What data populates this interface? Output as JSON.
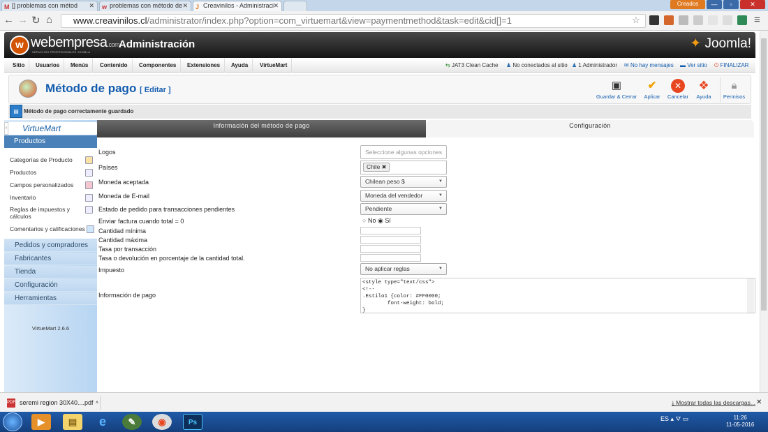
{
  "browser": {
    "tabs": [
      {
        "label": "[] problemas con métod",
        "icon": "M"
      },
      {
        "label": "problemas con método de",
        "icon": "w"
      },
      {
        "label": "Creavinilos - Administraci",
        "icon": "J"
      }
    ],
    "window_user": "Creados",
    "url_domain": "www.creavinilos.cl",
    "url_path": "/administrator/index.php?option=com_virtuemart&view=paymentmethod&task=edit&cid[]=1"
  },
  "header": {
    "brand": "webempresa",
    "brand_suffix": ".com",
    "brand_tagline": "SERVICIOS PROFESIONALES JOOMLA",
    "admin_title": "Administración",
    "joomla_logo": "Joomla!"
  },
  "menu": {
    "items": [
      "Sitio",
      "Usuarios",
      "Menús",
      "Contenido",
      "Componentes",
      "Extensiones",
      "Ayuda",
      "VirtueMart"
    ],
    "right": [
      "JAT3 Clean Cache",
      "No conectados al sitio",
      "1 Administrador",
      "No hay mensajes",
      "Ver sitio",
      "FINALIZAR"
    ]
  },
  "toolbar": {
    "title": "Método de pago",
    "title_sub": "[ Editar ]",
    "save_close": "Guardar & Cerrar",
    "apply": "Aplicar",
    "cancel": "Cancelar",
    "help": "Ayuda",
    "permissions": "Permisos"
  },
  "message": "Método de pago correctamente guardado",
  "sidebar": {
    "logo": "VirtueMart",
    "products_head": "Productos",
    "product_items": [
      "Categorías de Producto",
      "Productos",
      "Campos personalizados",
      "Inventario",
      "Reglas de impuestos y cálculos",
      "Comentarios y calificaciones"
    ],
    "sections": [
      "Pedidos y compradores",
      "Fabricantes",
      "Tienda",
      "Configuración",
      "Herramientas"
    ],
    "version": "VirtueMart 2.6.6"
  },
  "tabs": {
    "info": "Información del método de pago",
    "config": "Configuración"
  },
  "form": {
    "logos_label": "Logos",
    "logos_placeholder": "Seleccione algunas opciones",
    "countries_label": "Países",
    "countries_chip": "Chile",
    "currency_label": "Moneda aceptada",
    "currency_value": "Chilean peso $",
    "email_currency_label": "Moneda de E-mail",
    "email_currency_value": "Moneda del vendedor",
    "pending_label": "Estado de pedido para transacciones pendientes",
    "pending_value": "Pendiente",
    "invoice_label": "Enviar factura cuando total = 0",
    "radio_no": "No",
    "radio_si": "Sí",
    "min_label": "Cantidad mínima",
    "max_label": "Cantidad máxima",
    "fee_label": "Tasa por transacción",
    "percent_label": "Tasa o devolución en porcentaje de la cantidad total.",
    "tax_label": "Impuesto",
    "tax_value": "No aplicar reglas",
    "payinfo_label": "Información de pago",
    "payinfo_code": "<style type=\"text/css\">\n<!--\n.Estilo1 {color: #FF0000;\n        font-weight: bold;\n}"
  },
  "downloads": {
    "file": "seremi region 30X40....pdf",
    "show_all": "Mostrar todas las descargas..."
  },
  "taskbar": {
    "lang": "ES",
    "time": "11:26",
    "date": "11-05-2016"
  }
}
